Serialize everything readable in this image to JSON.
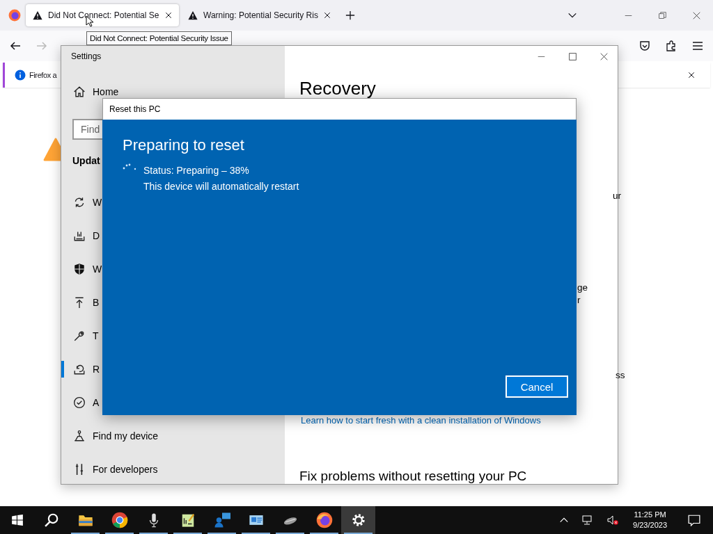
{
  "browser": {
    "tabs": [
      {
        "title": "Did Not Connect: Potential Se",
        "selected": true
      },
      {
        "title": "Warning: Potential Security Ris",
        "selected": false
      }
    ],
    "tooltip": "Did Not Connect: Potential Security Issue",
    "notification": "Firefox a"
  },
  "settings": {
    "title": "Settings",
    "home": "Home",
    "search": {
      "placeholder": "Find"
    },
    "section": "Updat",
    "items": [
      {
        "kind": "sync",
        "label": "W",
        "selected": false
      },
      {
        "kind": "delivery",
        "label": "D",
        "selected": false
      },
      {
        "kind": "shield",
        "label": "W",
        "selected": false
      },
      {
        "kind": "backup",
        "label": "B",
        "selected": false
      },
      {
        "kind": "wrench",
        "label": "T",
        "selected": false
      },
      {
        "kind": "recovery",
        "label": "R",
        "selected": true
      },
      {
        "kind": "check",
        "label": "A",
        "selected": false
      },
      {
        "kind": "find",
        "label": "Find my device",
        "selected": false
      },
      {
        "kind": "dev",
        "label": "For developers",
        "selected": false
      }
    ],
    "heading": "Recovery",
    "fragments": [
      "ur",
      "ge",
      "r",
      "ss"
    ],
    "link": "Learn how to start fresh with a clean installation of Windows",
    "subheading": "Fix problems without resetting your PC"
  },
  "dialog": {
    "title": "Reset this PC",
    "heading": "Preparing to reset",
    "status": "Status: Preparing – 38%",
    "note": "This device will automatically restart",
    "button": "Cancel"
  },
  "taskbar": {
    "apps": [
      {
        "kind": "start",
        "running": false,
        "selected": false
      },
      {
        "kind": "search",
        "running": false,
        "selected": false
      },
      {
        "kind": "explorer",
        "running": true,
        "selected": false
      },
      {
        "kind": "chrome",
        "running": true,
        "selected": false
      },
      {
        "kind": "mic",
        "running": true,
        "selected": false
      },
      {
        "kind": "notepad",
        "running": true,
        "selected": false
      },
      {
        "kind": "chat",
        "running": true,
        "selected": false
      },
      {
        "kind": "card",
        "running": true,
        "selected": false
      },
      {
        "kind": "mouse",
        "running": true,
        "selected": false
      },
      {
        "kind": "firefox",
        "running": true,
        "selected": false
      },
      {
        "kind": "gear",
        "running": true,
        "selected": true
      }
    ],
    "time": "11:25 PM",
    "date": "9/23/2023"
  }
}
